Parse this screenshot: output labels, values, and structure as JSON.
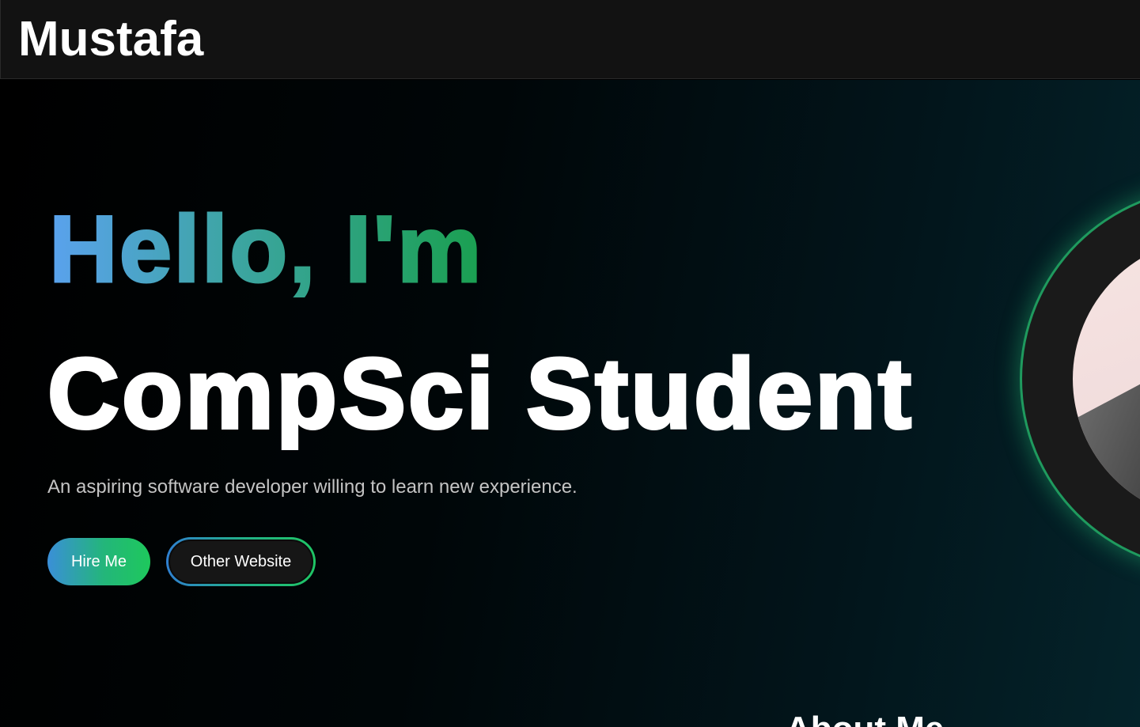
{
  "header": {
    "brand": "Mustafa"
  },
  "hero": {
    "greeting": "Hello, I'm",
    "role": "CompSci Student",
    "tagline": "An aspiring software developer willing to learn new experience.",
    "hire_button": "Hire Me",
    "other_button": "Other Website"
  },
  "about": {
    "heading": "About Me"
  },
  "colors": {
    "accent_blue": "#5aa2ee",
    "accent_green": "#1aa050",
    "background": "#000000",
    "header_bg": "#121212"
  }
}
